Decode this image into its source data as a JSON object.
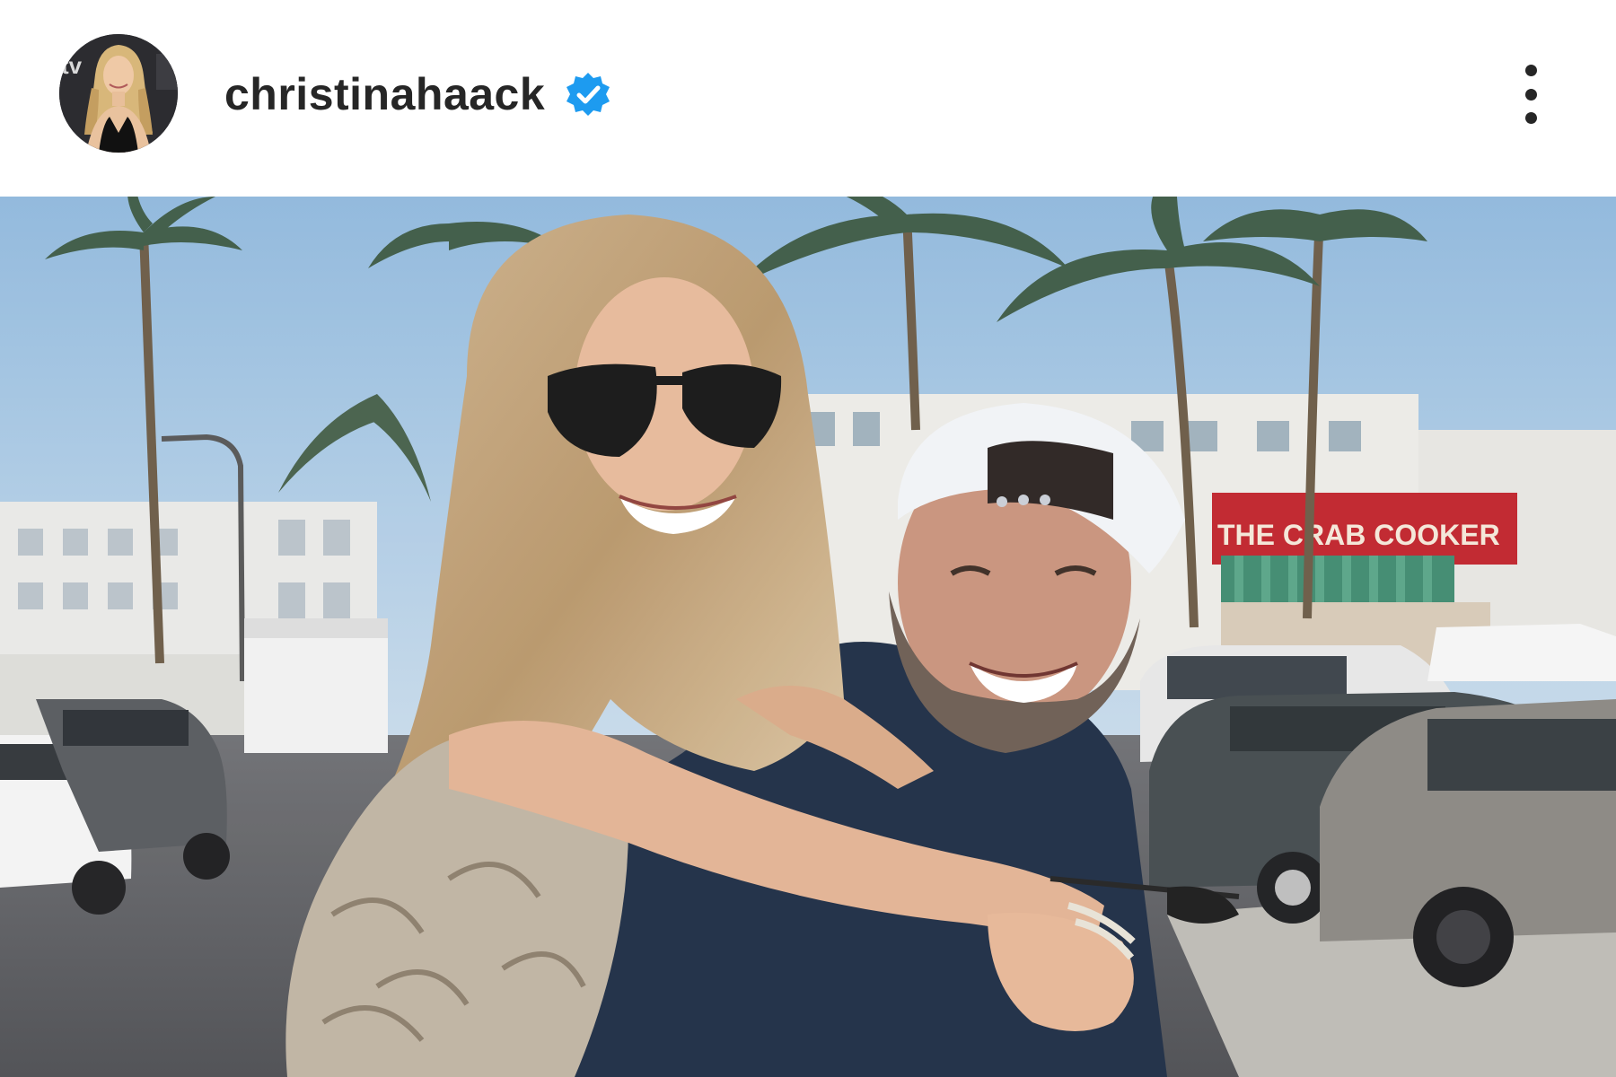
{
  "post": {
    "username": "christinahaack",
    "verified": true,
    "badge_color": "#1d9bf0",
    "more_icon": "vertical-ellipsis-icon"
  },
  "avatar_lettering": "tv",
  "photo": {
    "sign_text": "THE CRAB COOKER",
    "sign_color": "#c0232b"
  }
}
